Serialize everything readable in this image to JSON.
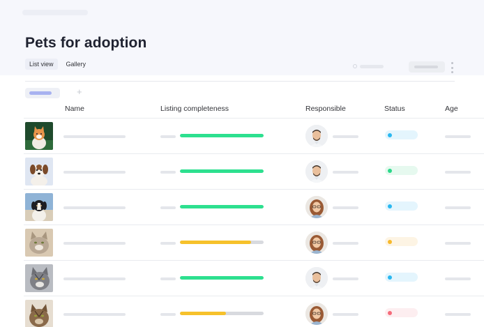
{
  "header": {
    "title": "Pets for adoption",
    "views": [
      {
        "label": "List view",
        "active": true
      },
      {
        "label": "Gallery",
        "active": false
      }
    ]
  },
  "table": {
    "columns": [
      "Name",
      "Listing completeness",
      "Responsible",
      "Status",
      "Age"
    ],
    "rows": [
      {
        "pet": "cat",
        "completeness": 1.0,
        "bar_color": "#2de08f",
        "responsible": "man",
        "status_bg": "#e4f5fd",
        "status_dot": "#2ab8f0"
      },
      {
        "pet": "dog",
        "completeness": 1.0,
        "bar_color": "#2de08f",
        "responsible": "man",
        "status_bg": "#e6f9ef",
        "status_dot": "#2ad88a"
      },
      {
        "pet": "dog",
        "completeness": 1.0,
        "bar_color": "#2de08f",
        "responsible": "woman",
        "status_bg": "#e4f5fd",
        "status_dot": "#2ab8f0"
      },
      {
        "pet": "cat",
        "completeness": 0.85,
        "bar_color": "#f6c12b",
        "responsible": "woman",
        "status_bg": "#fdf4e4",
        "status_dot": "#f7b92c"
      },
      {
        "pet": "cat",
        "completeness": 1.0,
        "bar_color": "#2de08f",
        "responsible": "man",
        "status_bg": "#e4f5fd",
        "status_dot": "#2ab8f0"
      },
      {
        "pet": "cat",
        "completeness": 0.55,
        "bar_color": "#f6c12b",
        "responsible": "woman",
        "status_bg": "#fdeef0",
        "status_dot": "#f56b7a"
      }
    ]
  },
  "colors": {
    "accent": "#a8b2f0",
    "complete": "#2de08f",
    "partial": "#f6c12b"
  }
}
